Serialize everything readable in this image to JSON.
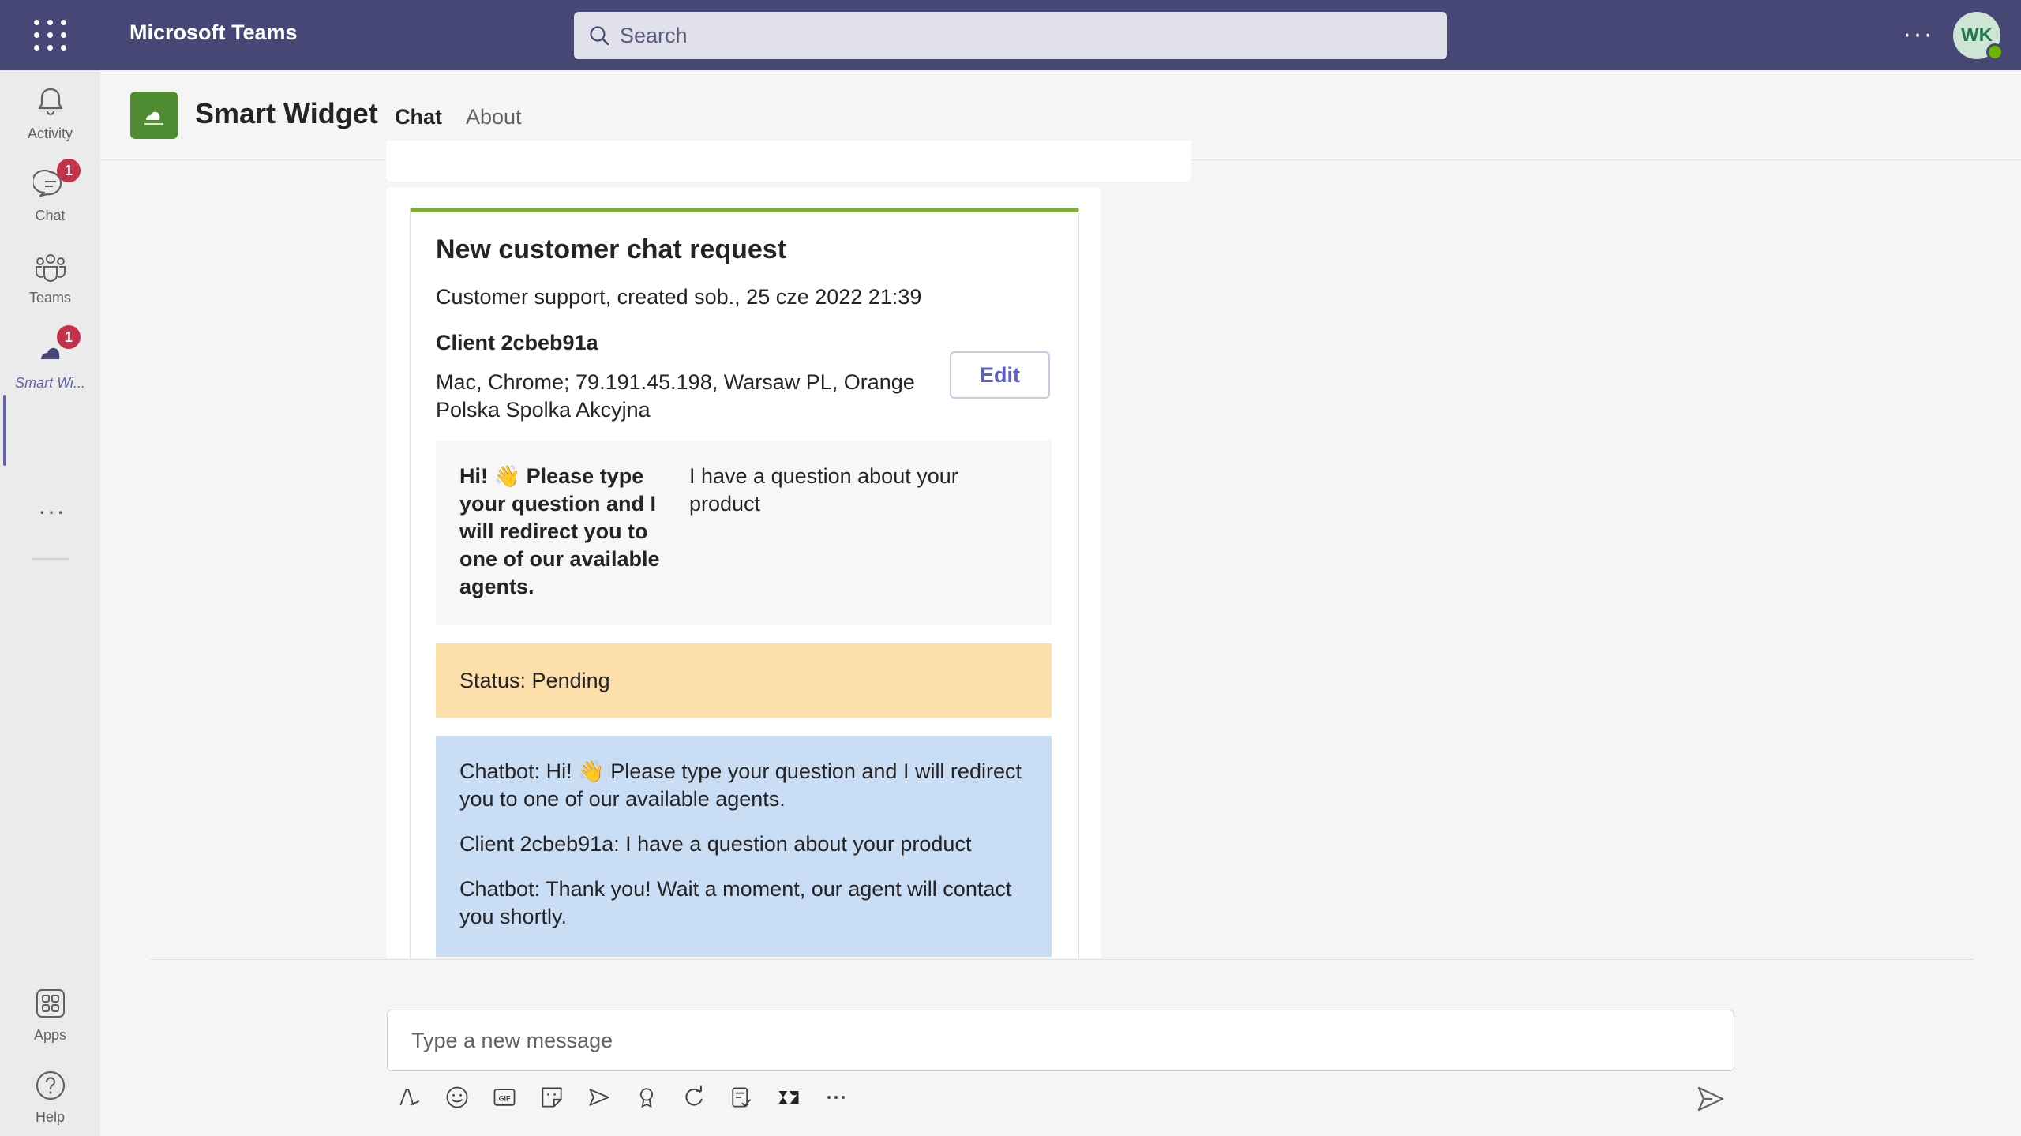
{
  "topbar": {
    "app_title": "Microsoft Teams",
    "search_placeholder": "Search",
    "more_label": "···",
    "avatar_initials": "WK"
  },
  "rail": {
    "items": [
      {
        "label": "Activity",
        "icon": "bell-icon"
      },
      {
        "label": "Chat",
        "icon": "chat-icon",
        "badge": "1"
      },
      {
        "label": "Teams",
        "icon": "teams-icon"
      },
      {
        "label": "Smart Wi...",
        "icon": "smart-widget-icon",
        "badge": "1"
      },
      {
        "label": "Apps",
        "icon": "apps-icon"
      },
      {
        "label": "Help",
        "icon": "help-icon"
      }
    ],
    "more_label": "···"
  },
  "header": {
    "app_name": "Smart Widget",
    "tabs": [
      {
        "label": "Chat",
        "active": true
      },
      {
        "label": "About",
        "active": false
      }
    ]
  },
  "card": {
    "title": "New customer chat request",
    "subtitle": "Customer support, created sob., 25 cze 2022 21:39",
    "client_name": "Client 2cbeb91a",
    "client_info": "Mac, Chrome; 79.191.45.198, Warsaw PL, Orange Polska Spolka Akcyjna",
    "edit_label": "Edit",
    "question": "Hi! 👋 Please type your question and I will redirect you to one of our available agents.",
    "answer": "I have a question about your product",
    "status": "Status: Pending",
    "transcript": [
      "Chatbot: Hi! 👋 Please type your question and I will redirect you to one of our available agents.",
      "Client 2cbeb91a: I have a question about your product",
      "Chatbot: Thank you! Wait a moment, our agent will contact you shortly."
    ]
  },
  "compose": {
    "placeholder": "Type a new message"
  },
  "colors": {
    "topbar": "#464775",
    "accent": "#6264a7",
    "card_border": "#7fab3e",
    "status_bg": "#fddfab",
    "transcript_bg": "#c9ddf4",
    "badge": "#c4314b"
  }
}
